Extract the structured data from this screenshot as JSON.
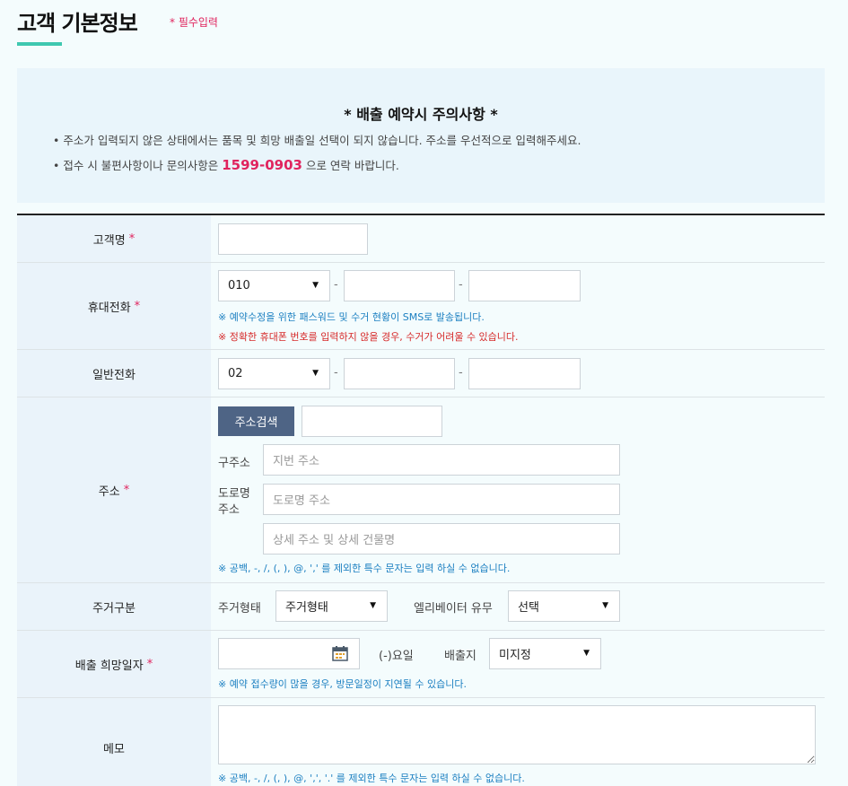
{
  "header": {
    "title": "고객 기본정보",
    "required_note": "* 필수입력"
  },
  "notice": {
    "title": "* 배출 예약시 주의사항 *",
    "line1": "• 주소가 입력되지 않은 상태에서는 품목 및 희망 배출일 선택이 되지 않습니다. 주소를 우선적으로 입력해주세요.",
    "line2_prefix": "• 접수 시 불편사항이나 문의사항은 ",
    "line2_phone": "1599-0903",
    "line2_suffix": " 으로 연락 바랍니다."
  },
  "form": {
    "required_mark": "*",
    "customer_name": {
      "label": "고객명",
      "value": ""
    },
    "mobile": {
      "label": "휴대전화",
      "prefix_selected": "010",
      "dash": "-",
      "note1": "※ 예약수정을 위한 패스워드 및 수거 현황이 SMS로 발송됩니다.",
      "note2": "※ 정확한 휴대폰 번호를 입력하지 않을 경우, 수거가 어려울 수 있습니다."
    },
    "landline": {
      "label": "일반전화",
      "prefix_selected": "02",
      "dash": "-"
    },
    "address": {
      "label": "주소",
      "search_button": "주소검색",
      "old_label": "구주소",
      "old_placeholder": "지번 주소",
      "road_label_1": "도로명",
      "road_label_2": "주소",
      "road_placeholder": "도로명 주소",
      "detail_placeholder": "상세 주소 및 상세 건물명",
      "note": "※ 공백, -, /, (, ), @, ',' 를 제외한 특수 문자는 입력 하실 수 없습니다."
    },
    "housing": {
      "label": "주거구분",
      "type_label": "주거형태",
      "type_selected": "주거형태",
      "elevator_label": "엘리베이터 유무",
      "elevator_selected": "선택"
    },
    "schedule": {
      "label": "배출 희망일자",
      "weekday": "(-)요일",
      "location_label": "배출지",
      "location_selected": "미지정",
      "note": "※ 예약 접수량이 많을 경우, 방문일정이 지연될 수 있습니다."
    },
    "memo": {
      "label": "메모",
      "note": "※ 공백, -, /, (, ), @, ',', '.' 를 제외한 특수 문자는 입력 하실 수 없습니다."
    }
  },
  "icons": {
    "dropdown": "chevron-down-icon",
    "calendar": "calendar-icon"
  },
  "colors": {
    "accent_red": "#e0245e",
    "accent_teal": "#3fc8b0",
    "button_navy": "#4e6485",
    "note_blue": "#1b7fc1"
  }
}
